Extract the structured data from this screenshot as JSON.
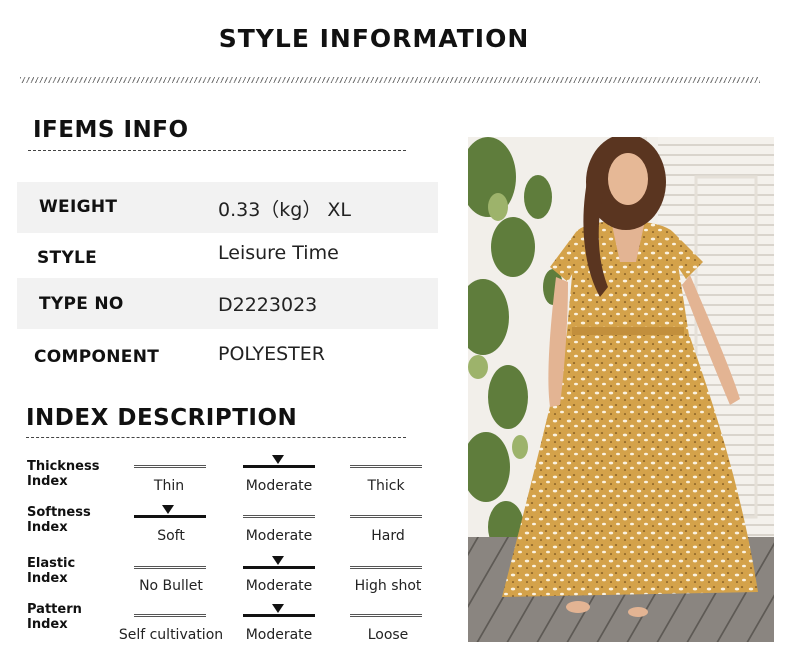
{
  "page_title": "STYLE INFORMATION",
  "items_info": {
    "heading": "IFEMS INFO",
    "rows": [
      {
        "key": "WEIGHT",
        "value": "0.33（kg） XL"
      },
      {
        "key": "STYLE",
        "value": "Leisure Time"
      },
      {
        "key": "TYPE NO",
        "value": "D2223023"
      },
      {
        "key": "COMPONENT",
        "value": "POLYESTER"
      }
    ]
  },
  "index_description": {
    "heading": "INDEX DESCRIPTION",
    "rows": [
      {
        "label_line1": "Thickness",
        "label_line2": "Index",
        "options": [
          "Thin",
          "Moderate",
          "Thick"
        ],
        "selected": 1
      },
      {
        "label_line1": "Softness",
        "label_line2": "Index",
        "options": [
          "Soft",
          "Moderate",
          "Hard"
        ],
        "selected": 0
      },
      {
        "label_line1": "Elastic",
        "label_line2": "Index",
        "options": [
          "No Bullet",
          "Moderate",
          "High shot"
        ],
        "selected": 1
      },
      {
        "label_line1": "Pattern",
        "label_line2": "Index",
        "options": [
          "Self cultivation",
          "Moderate",
          "Loose"
        ],
        "selected": 1
      }
    ]
  },
  "product_photo": {
    "subject": "model in yellow leopard-print wrap maxi dress",
    "dress_color": "#d4a24a",
    "wall_color": "#f4f1ec",
    "deck_color": "#8a8580"
  }
}
